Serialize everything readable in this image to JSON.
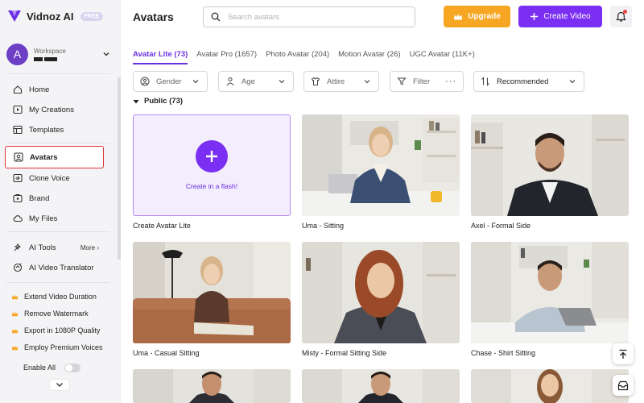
{
  "brand": {
    "name": "Vidnoz AI",
    "badge": "FREE"
  },
  "workspace": {
    "label": "Workspace",
    "initial": "A"
  },
  "nav": {
    "home": "Home",
    "creations": "My Creations",
    "templates": "Templates",
    "avatars": "Avatars",
    "clone_voice": "Clone Voice",
    "brand": "Brand",
    "files": "My Files",
    "ai_tools": "AI Tools",
    "more": "More",
    "translator": "AI Video Translator"
  },
  "perks": [
    "Extend Video Duration",
    "Remove Watermark",
    "Export in 1080P Quality",
    "Employ Premium Voices"
  ],
  "enable_all": "Enable All",
  "header": {
    "title": "Avatars",
    "search_placeholder": "Search avatars",
    "upgrade": "Upgrade",
    "create_video": "Create Video"
  },
  "tabs": [
    "Avatar Lite (73)",
    "Avatar Pro (1657)",
    "Photo Avatar (204)",
    "Motion Avatar (26)",
    "UGC Avatar (11K+)"
  ],
  "filters": {
    "gender": "Gender",
    "age": "Age",
    "attire": "Attire",
    "filter": "Filter",
    "sort": "Recommended"
  },
  "section_title": "Public (73)",
  "create_card": {
    "sub": "Create in a flash!",
    "caption": "Create Avatar Lite"
  },
  "avatars": [
    "Uma - Sitting",
    "Axel - Formal Side",
    "Uma - Casual Sitting",
    "Misty - Formal Sitting Side",
    "Chase - Shirt Sitting"
  ],
  "colors": {
    "accent": "#7b2ff2",
    "upgrade": "#f6a623",
    "active_outline": "#e03434"
  }
}
